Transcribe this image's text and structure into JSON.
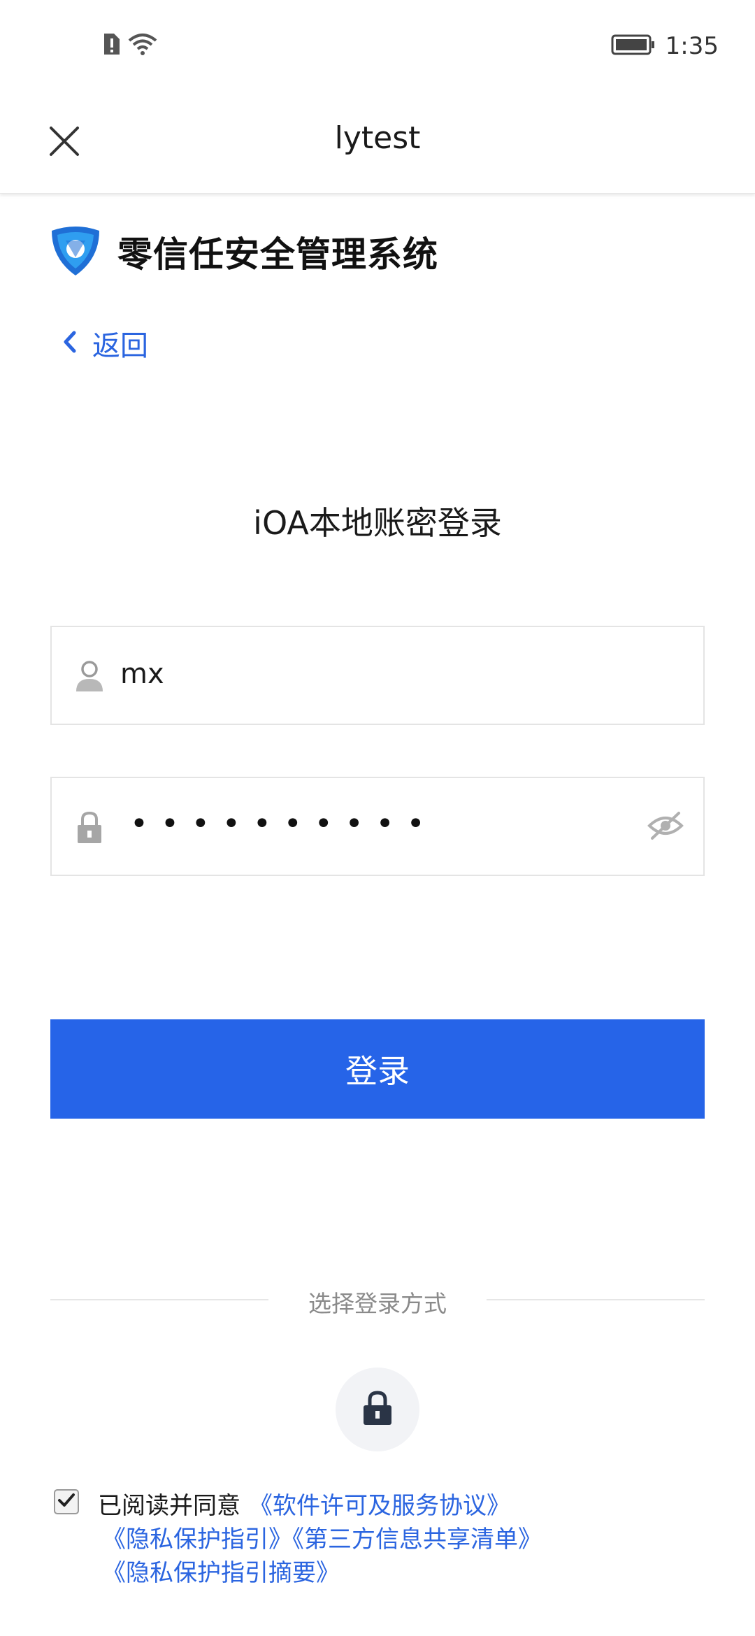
{
  "status_bar": {
    "time": "1:35",
    "icons": [
      "alert-sim-icon",
      "wifi-icon",
      "battery-icon"
    ]
  },
  "nav": {
    "title": "lytest",
    "close_icon": "close-icon"
  },
  "brand": {
    "name": "零信任安全管理系统",
    "logo_icon": "shield-logo-icon"
  },
  "back": {
    "label": "返回",
    "icon": "chevron-left-icon"
  },
  "login": {
    "title": "iOA本地账密登录",
    "username_value": "mx",
    "password_mask": "••••••••••",
    "button_label": "登录"
  },
  "methods": {
    "divider_label": "选择登录方式",
    "options": [
      {
        "icon": "lock-icon"
      }
    ]
  },
  "agreement": {
    "checked": true,
    "prefix": "已阅读并同意",
    "links": [
      "《软件许可及服务协议》",
      "《隐私保护指引》",
      "《第三方信息共享清单》",
      "《隐私保护指引摘要》"
    ]
  },
  "colors": {
    "primary": "#2664e8",
    "link": "#2b65e0",
    "field_border": "#e4e4e4",
    "muted_text": "#8a8a8a"
  }
}
